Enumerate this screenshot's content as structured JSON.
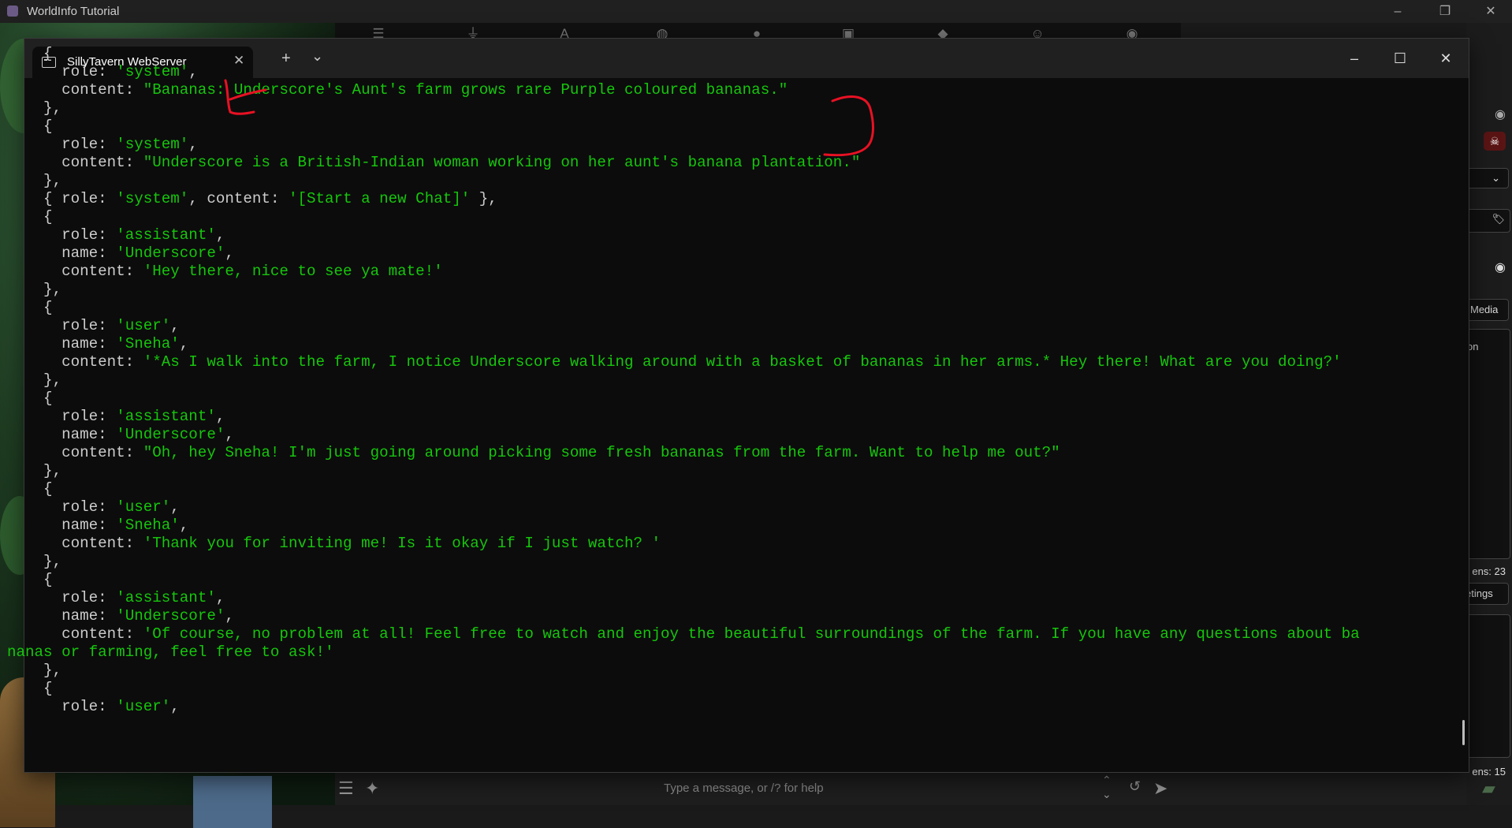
{
  "outer_window": {
    "title": "WorldInfo Tutorial",
    "controls": [
      "–",
      "❐",
      "✕"
    ]
  },
  "background_ui": {
    "right_panel": {
      "media_label": "Media",
      "fragment_on": "on",
      "tokens_top": "ens: 23",
      "greetings_fragment": "etings",
      "tokens_bottom": "ens: 15"
    },
    "input_placeholder": "Type a message, or /? for help"
  },
  "terminal": {
    "tab_title": "SillyTavern WebServer",
    "new_tab": "+",
    "dropdown": "⌄",
    "controls": [
      "–",
      "☐",
      "✕"
    ],
    "lines": [
      [
        {
          "t": "    {"
        }
      ],
      [
        {
          "t": "      role: "
        },
        {
          "t": "'system'",
          "c": "s"
        },
        {
          "t": ","
        }
      ],
      [
        {
          "t": "      content: "
        },
        {
          "t": "\"Bananas: Underscore's Aunt's farm grows rare Purple coloured bananas.\"",
          "c": "s"
        }
      ],
      [
        {
          "t": "    },"
        }
      ],
      [
        {
          "t": "    {"
        }
      ],
      [
        {
          "t": "      role: "
        },
        {
          "t": "'system'",
          "c": "s"
        },
        {
          "t": ","
        }
      ],
      [
        {
          "t": "      content: "
        },
        {
          "t": "\"Underscore is a British-Indian woman working on her aunt's banana plantation.\"",
          "c": "s"
        }
      ],
      [
        {
          "t": "    },"
        }
      ],
      [
        {
          "t": "    { role: "
        },
        {
          "t": "'system'",
          "c": "s"
        },
        {
          "t": ", content: "
        },
        {
          "t": "'[Start a new Chat]'",
          "c": "s"
        },
        {
          "t": " },"
        }
      ],
      [
        {
          "t": "    {"
        }
      ],
      [
        {
          "t": "      role: "
        },
        {
          "t": "'assistant'",
          "c": "s"
        },
        {
          "t": ","
        }
      ],
      [
        {
          "t": "      name: "
        },
        {
          "t": "'Underscore'",
          "c": "s"
        },
        {
          "t": ","
        }
      ],
      [
        {
          "t": "      content: "
        },
        {
          "t": "'Hey there, nice to see ya mate!'",
          "c": "s"
        }
      ],
      [
        {
          "t": "    },"
        }
      ],
      [
        {
          "t": "    {"
        }
      ],
      [
        {
          "t": "      role: "
        },
        {
          "t": "'user'",
          "c": "s"
        },
        {
          "t": ","
        }
      ],
      [
        {
          "t": "      name: "
        },
        {
          "t": "'Sneha'",
          "c": "s"
        },
        {
          "t": ","
        }
      ],
      [
        {
          "t": "      content: "
        },
        {
          "t": "'*As I walk into the farm, I notice Underscore walking around with a basket of bananas in her arms.* Hey there! What are you doing?'",
          "c": "s"
        }
      ],
      [
        {
          "t": "    },"
        }
      ],
      [
        {
          "t": "    {"
        }
      ],
      [
        {
          "t": "      role: "
        },
        {
          "t": "'assistant'",
          "c": "s"
        },
        {
          "t": ","
        }
      ],
      [
        {
          "t": "      name: "
        },
        {
          "t": "'Underscore'",
          "c": "s"
        },
        {
          "t": ","
        }
      ],
      [
        {
          "t": "      content: "
        },
        {
          "t": "\"Oh, hey Sneha! I'm just going around picking some fresh bananas from the farm. Want to help me out?\"",
          "c": "s"
        }
      ],
      [
        {
          "t": "    },"
        }
      ],
      [
        {
          "t": "    {"
        }
      ],
      [
        {
          "t": "      role: "
        },
        {
          "t": "'user'",
          "c": "s"
        },
        {
          "t": ","
        }
      ],
      [
        {
          "t": "      name: "
        },
        {
          "t": "'Sneha'",
          "c": "s"
        },
        {
          "t": ","
        }
      ],
      [
        {
          "t": "      content: "
        },
        {
          "t": "'Thank you for inviting me! Is it okay if I just watch? '",
          "c": "s"
        }
      ],
      [
        {
          "t": "    },"
        }
      ],
      [
        {
          "t": "    {"
        }
      ],
      [
        {
          "t": "      role: "
        },
        {
          "t": "'assistant'",
          "c": "s"
        },
        {
          "t": ","
        }
      ],
      [
        {
          "t": "      name: "
        },
        {
          "t": "'Underscore'",
          "c": "s"
        },
        {
          "t": ","
        }
      ],
      [
        {
          "t": "      content: "
        },
        {
          "t": "'Of course, no problem at all! Feel free to watch and enjoy the beautiful surroundings of the farm. If you have any questions about ba",
          "c": "s"
        }
      ],
      [
        {
          "t": "nanas or farming, feel free to ask!'",
          "c": "s"
        }
      ],
      [
        {
          "t": "    },"
        }
      ],
      [
        {
          "t": "    {"
        }
      ],
      [
        {
          "t": "      role: "
        },
        {
          "t": "'user'",
          "c": "s"
        },
        {
          "t": ","
        }
      ]
    ]
  },
  "colors": {
    "terminal_bg": "#0c0c0c",
    "string_green": "#16c60c",
    "default_text": "#cccccc",
    "annotation_red": "#e81123"
  }
}
